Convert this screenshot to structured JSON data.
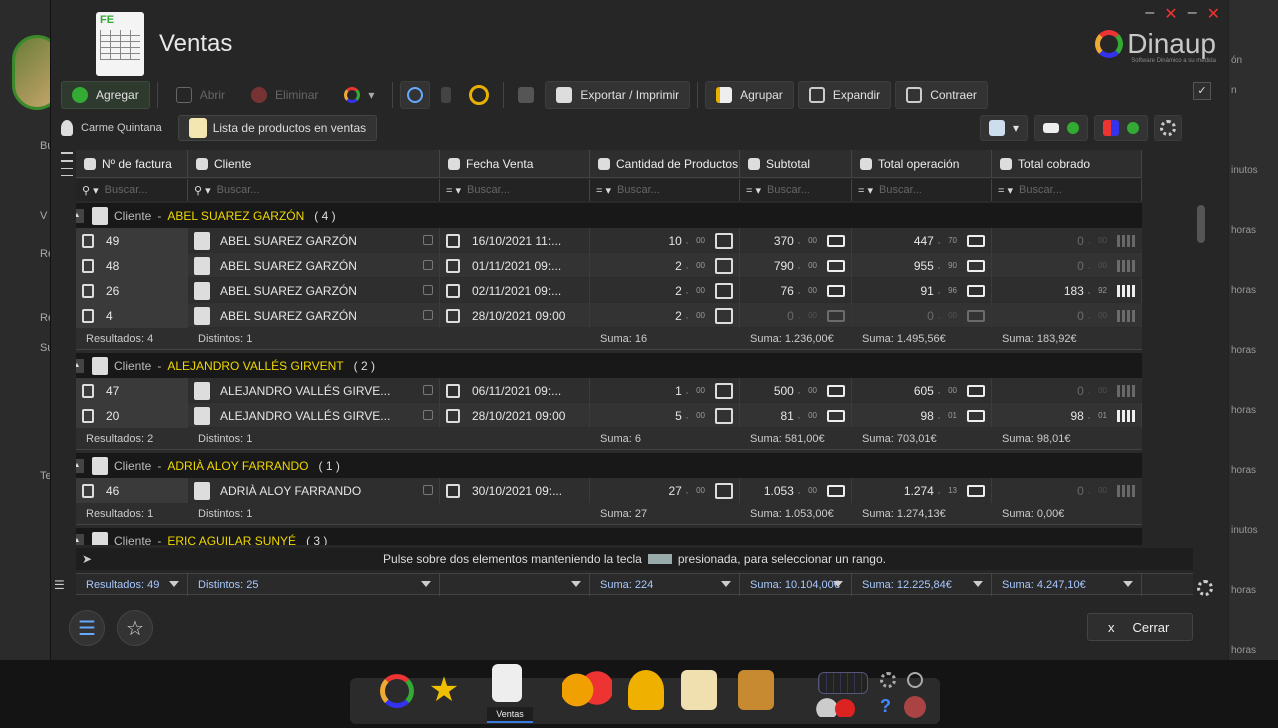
{
  "window": {
    "title": "Ventas",
    "logo": "Dinaup",
    "logo_sub": "Software Dinámico a su medida",
    "close_glyph": "x"
  },
  "toolbar": {
    "add": "Agregar",
    "open": "Abrir",
    "delete": "Eliminar",
    "export": "Exportar / Imprimir",
    "group": "Agrupar",
    "expand": "Expandir",
    "collapse": "Contraer"
  },
  "context": {
    "user": "Carme Quintana",
    "list": "Lista de productos en ventas"
  },
  "columns": [
    "Nº de factura",
    "Cliente",
    "Fecha Venta",
    "Cantidad de Productos",
    "Subtotal",
    "Total operación",
    "Total cobrado"
  ],
  "filter_placeholder": "Buscar...",
  "group_label": "Cliente",
  "groups": [
    {
      "name": "ABEL SUAREZ GARZÓN",
      "count": "( 4 )",
      "rows": [
        {
          "n": "49",
          "c": "ABEL SUAREZ GARZÓN",
          "d": "16/10/2021 11:...",
          "q": "10",
          "qd": "00",
          "s": "370",
          "sd": "00",
          "t": "447",
          "td": "70",
          "p": "0",
          "pd": "00"
        },
        {
          "n": "48",
          "c": "ABEL SUAREZ GARZÓN",
          "d": "01/11/2021 09:...",
          "q": "2",
          "qd": "00",
          "s": "790",
          "sd": "00",
          "t": "955",
          "td": "90",
          "p": "0",
          "pd": "00"
        },
        {
          "n": "26",
          "c": "ABEL SUAREZ GARZÓN",
          "d": "02/11/2021 09:...",
          "q": "2",
          "qd": "00",
          "s": "76",
          "sd": "00",
          "t": "91",
          "td": "96",
          "p": "183",
          "pd": "92"
        },
        {
          "n": "4",
          "c": "ABEL SUAREZ GARZÓN",
          "d": "28/10/2021 09:00",
          "q": "2",
          "qd": "00",
          "s": "0",
          "sd": "00",
          "t": "0",
          "td": "00",
          "p": "0",
          "pd": "00"
        }
      ],
      "sum": {
        "res": "Resultados: 4",
        "dis": "Distintos: 1",
        "q": "Suma: 16",
        "s": "Suma: 1.236,00€",
        "t": "Suma: 1.495,56€",
        "p": "Suma: 183,92€"
      }
    },
    {
      "name": "ALEJANDRO VALLÉS GIRVENT",
      "count": "( 2 )",
      "rows": [
        {
          "n": "47",
          "c": "ALEJANDRO VALLÉS GIRVE...",
          "d": "06/11/2021 09:...",
          "q": "1",
          "qd": "00",
          "s": "500",
          "sd": "00",
          "t": "605",
          "td": "00",
          "p": "0",
          "pd": "00"
        },
        {
          "n": "20",
          "c": "ALEJANDRO VALLÉS GIRVE...",
          "d": "28/10/2021 09:00",
          "q": "5",
          "qd": "00",
          "s": "81",
          "sd": "00",
          "t": "98",
          "td": "01",
          "p": "98",
          "pd": "01"
        }
      ],
      "sum": {
        "res": "Resultados: 2",
        "dis": "Distintos: 1",
        "q": "Suma: 6",
        "s": "Suma: 581,00€",
        "t": "Suma: 703,01€",
        "p": "Suma: 98,01€"
      }
    },
    {
      "name": "ADRIÀ ALOY FARRANDO",
      "count": "( 1 )",
      "rows": [
        {
          "n": "46",
          "c": "ADRIÀ ALOY FARRANDO",
          "d": "30/10/2021 09:...",
          "q": "27",
          "qd": "00",
          "s": "1.053",
          "sd": "00",
          "t": "1.274",
          "td": "13",
          "p": "0",
          "pd": "00"
        }
      ],
      "sum": {
        "res": "Resultados: 1",
        "dis": "Distintos: 1",
        "q": "Suma: 27",
        "s": "Suma: 1.053,00€",
        "t": "Suma: 1.274,13€",
        "p": "Suma: 0,00€"
      }
    },
    {
      "name": "ERIC AGUILAR SUNYÉ",
      "count": "( 3 )",
      "rows": [],
      "sum": null
    }
  ],
  "hint": {
    "before": "Pulse sobre dos elementos manteniendo la tecla",
    "after": "presionada, para seleccionar un rango."
  },
  "footer": {
    "res": "Resultados: 49",
    "dis": "Distintos: 25",
    "q": "Suma: 224",
    "s": "Suma: 10.104,00€",
    "t": "Suma: 12.225,84€",
    "p": "Suma: 4.247,10€"
  },
  "close": "Cerrar",
  "dock_label": "Ventas",
  "left_labels": [
    "Bu",
    "V",
    "Re",
    "Re",
    "Su",
    "Te"
  ],
  "right_labels": [
    "ón",
    "n",
    "inutos",
    "horas",
    "horas",
    "horas",
    "horas",
    "horas",
    "inutos",
    "horas",
    "horas"
  ]
}
